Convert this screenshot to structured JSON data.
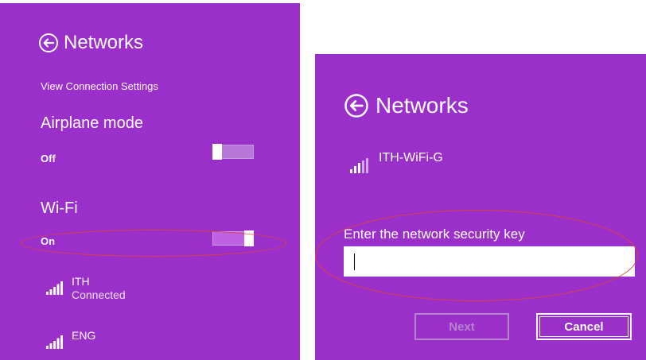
{
  "colors": {
    "accent": "#9b2fc9",
    "ellipse": "#d9443d",
    "toggle_track": "#b777d6"
  },
  "left": {
    "title": "Networks",
    "view_settings": "View Connection Settings",
    "airplane": {
      "label": "Airplane mode",
      "state": "Off",
      "on": false
    },
    "wifi": {
      "label": "Wi-Fi",
      "state": "On",
      "on": true
    },
    "networks": [
      {
        "name": "ITH",
        "status": "Connected",
        "icon": "wifi-signal-icon"
      },
      {
        "name": "ENG",
        "status": "",
        "icon": "wifi-signal-icon"
      }
    ]
  },
  "right": {
    "title": "Networks",
    "network": {
      "name": "ITH-WiFi-G",
      "icon": "wifi-signal-icon"
    },
    "key_prompt": "Enter the network security key",
    "key_value": "",
    "next_label": "Next",
    "cancel_label": "Cancel"
  }
}
